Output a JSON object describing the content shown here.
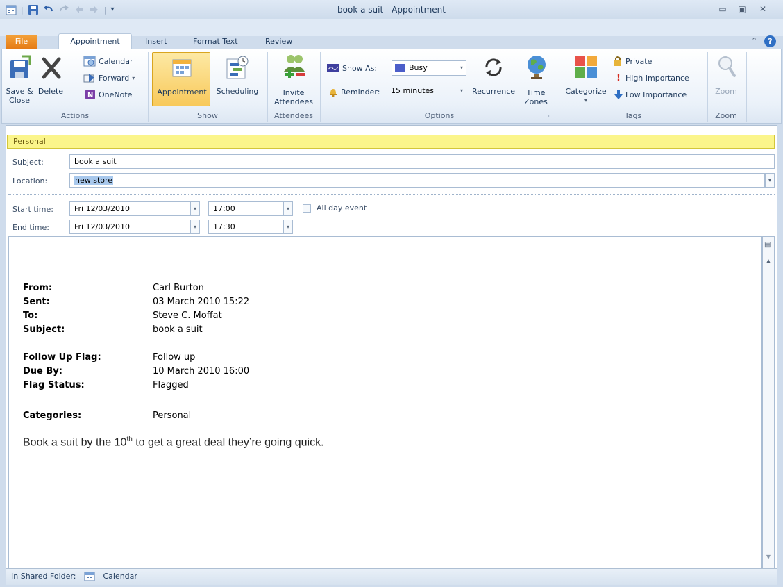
{
  "window": {
    "title": "book a suit - Appointment"
  },
  "tabs": {
    "file": "File",
    "appointment": "Appointment",
    "insert": "Insert",
    "format_text": "Format Text",
    "review": "Review"
  },
  "ribbon": {
    "actions": {
      "save_close_1": "Save &",
      "save_close_2": "Close",
      "delete": "Delete",
      "calendar": "Calendar",
      "forward": "Forward",
      "onenote": "OneNote",
      "label": "Actions"
    },
    "show": {
      "appointment": "Appointment",
      "scheduling": "Scheduling",
      "label": "Show"
    },
    "attendees": {
      "invite_1": "Invite",
      "invite_2": "Attendees",
      "label": "Attendees"
    },
    "options": {
      "show_as_label": "Show As:",
      "show_as_value": "Busy",
      "reminder_label": "Reminder:",
      "reminder_value": "15 minutes",
      "recurrence": "Recurrence",
      "time_zones_1": "Time",
      "time_zones_2": "Zones",
      "label": "Options"
    },
    "tags": {
      "categorize": "Categorize",
      "private": "Private",
      "high": "High Importance",
      "low": "Low Importance",
      "label": "Tags"
    },
    "zoom": {
      "zoom": "Zoom",
      "label": "Zoom"
    }
  },
  "form": {
    "category_bar": "Personal",
    "subject_label": "Subject:",
    "subject_value": "book a suit",
    "location_label": "Location:",
    "location_value": "new store",
    "start_label": "Start time:",
    "start_date": "Fri 12/03/2010",
    "start_time": "17:00",
    "all_day_label": "All day event",
    "end_label": "End time:",
    "end_date": "Fri 12/03/2010",
    "end_time": "17:30"
  },
  "body": {
    "from_label": "From:",
    "from_value": "Carl Burton",
    "sent_label": "Sent:",
    "sent_value": "03 March 2010 15:22",
    "to_label": "To:",
    "to_value": "Steve C. Moffat",
    "subject_label": "Subject:",
    "subject_value": "book a suit",
    "flag_label": "Follow Up Flag:",
    "flag_value": "Follow up",
    "due_label": "Due By:",
    "due_value": "10 March 2010 16:00",
    "status_label": "Flag Status:",
    "status_value": "Flagged",
    "categories_label": "Categories:",
    "categories_value": "Personal",
    "message_pre": "Book a suit by the 10",
    "message_sup": "th",
    "message_post": " to get a great deal they’re going quick."
  },
  "status": {
    "shared_label": "In Shared Folder:",
    "folder": "Calendar"
  },
  "colors": {
    "category_personal": "#fbf58b",
    "file_tab": "#e57b16"
  }
}
